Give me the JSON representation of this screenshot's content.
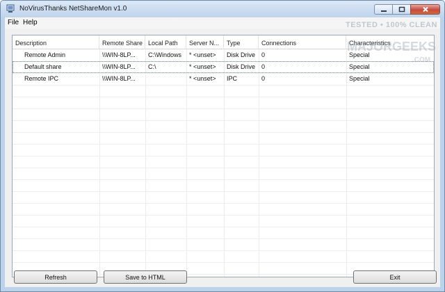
{
  "window": {
    "title": "NoVirusThanks NetShareMon v1.0"
  },
  "menu": {
    "items": [
      "File",
      "Help"
    ]
  },
  "table": {
    "columns": [
      "Description",
      "Remote Share",
      "Local Path",
      "Server N...",
      "Type",
      "Connections",
      "Characteristics"
    ],
    "rows": [
      [
        "Remote Admin",
        "\\\\WIN-8LP...",
        "C:\\Windows",
        "* <unset>",
        "Disk Drive",
        "0",
        "Special"
      ],
      [
        "Default share",
        "\\\\WIN-8LP...",
        "C:\\",
        "* <unset>",
        "Disk Drive",
        "0",
        "Special"
      ],
      [
        "Remote IPC",
        "\\\\WIN-8LP...",
        "",
        "* <unset>",
        "IPC",
        "0",
        "Special"
      ]
    ]
  },
  "buttons": {
    "refresh": "Refresh",
    "save": "Save to HTML",
    "exit": "Exit"
  },
  "watermark": {
    "line1": "TESTED • 100% CLEAN",
    "line2": "MAJORGEEKS",
    "line3": ".COM"
  },
  "colors": {
    "titlebar": "#bfd4ec",
    "close_button": "#c44a3c",
    "client": "#f0f0f0"
  },
  "icons": [
    "app-icon",
    "minimize-icon",
    "maximize-icon",
    "close-icon"
  ]
}
